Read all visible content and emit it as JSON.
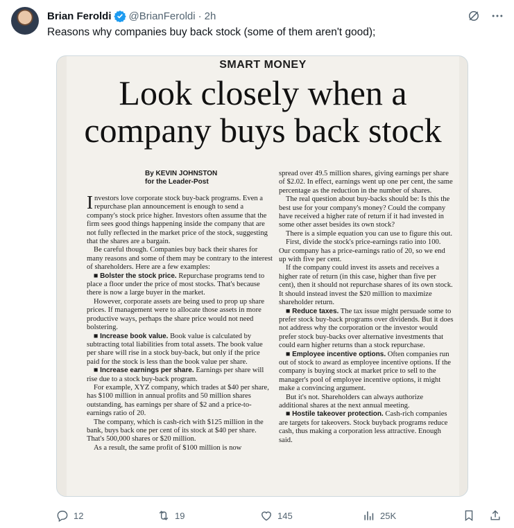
{
  "author": {
    "name": "Brian Feroldi",
    "handle": "@BrianFeroldi",
    "separator": "·",
    "time": "2h",
    "verified_color": "#1d9bf0"
  },
  "tweet": {
    "text": "Reasons why companies buy back stock (some of them aren't good);"
  },
  "clipping": {
    "kicker": "SMART MONEY",
    "headline_line1": "Look closely when a",
    "headline_line2": "company buys back stock",
    "byline_1": "By KEVIN JOHNSTON",
    "byline_2": "for the Leader-Post",
    "left": {
      "dropcap": "I",
      "p1": "nvestors love corporate stock buy-back programs. Even a repurchase plan announcement is enough to send a company's stock price higher. Investors often assume that the firm sees good things happening inside the company that are not fully reflected in the market price of the stock, suggesting that the shares are a bargain.",
      "p2": "Be careful though. Companies buy back their shares for many reasons and some of them may be contrary to the interest of shareholders. Here are a few examples:",
      "b1": "Bolster the stock price.",
      "p3": "Repurchase programs tend to place a floor under the price of most stocks. That's because there is now a large buyer in the market.",
      "p4": "However, corporate assets are being used to prop up share prices. If management were to allocate those assets in more productive ways, perhaps the share price would not need bolstering.",
      "b2": "Increase book value.",
      "p5": "Book value is calculated by subtracting total liabilities from total assets. The book value per share will rise in a stock buy-back, but only if the price paid for the stock is less than the book value per share.",
      "b3": "Increase earnings per share.",
      "p6": "Earnings per share will rise due to a stock buy-back program.",
      "p7": "For example, XYZ company, which trades at $40 per share, has $100 million in annual profits and 50 million shares outstanding, has earnings per share of $2 and a price-to-earnings ratio of 20.",
      "p8": "The company, which is cash-rich with $125 million in the bank, buys back one per cent of its stock at $40 per share. That's 500,000 shares or $20 million.",
      "p9": "As a result, the same profit of $100 million is now"
    },
    "right": {
      "p1": "spread over 49.5 million shares, giving earnings per share of $2.02. In effect, earnings went up one per cent, the same percentage as the reduction in the number of shares.",
      "p2": "The real question about buy-backs should be: Is this the best use for your company's money? Could the company have received a higher rate of return if it had invested in some other asset besides its own stock?",
      "p3": "There is a simple equation you can use to figure this out.",
      "p4": "First, divide the stock's price-earnings ratio into 100. Our company has a price-earnings ratio of 20, so we end up with five per cent.",
      "p5": "If the company could invest its assets and receives a higher rate of return (in this case, higher than five per cent), then it should not repurchase shares of its own stock. It should instead invest the $20 million to maximize shareholder return.",
      "b1": "Reduce taxes.",
      "p6": "The tax issue might persuade some to prefer stock buy-back programs over dividends. But it does not address why the corporation or the investor would prefer stock buy-backs over alternative investments that could earn higher returns than a stock repurchase.",
      "b2": "Employee incentive options.",
      "p7": "Often companies run out of stock to award as employee incentive options. If the company is buying stock at market price to sell to the manager's pool of employee incentive options, it might make a convincing argument.",
      "p8": "But it's not. Shareholders can always authorize additional shares at the next annual meeting.",
      "b3": "Hostile takeover protection.",
      "p9": "Cash-rich companies are targets for takeovers. Stock buyback programs reduce cash, thus making a corporation less attractive. Enough said."
    }
  },
  "actions": {
    "replies": "12",
    "reposts": "19",
    "likes": "145",
    "views": "25K"
  },
  "icons": [
    "verified-icon",
    "grok-icon",
    "more-icon",
    "reply-icon",
    "repost-icon",
    "like-icon",
    "views-icon",
    "bookmark-icon",
    "share-icon"
  ]
}
